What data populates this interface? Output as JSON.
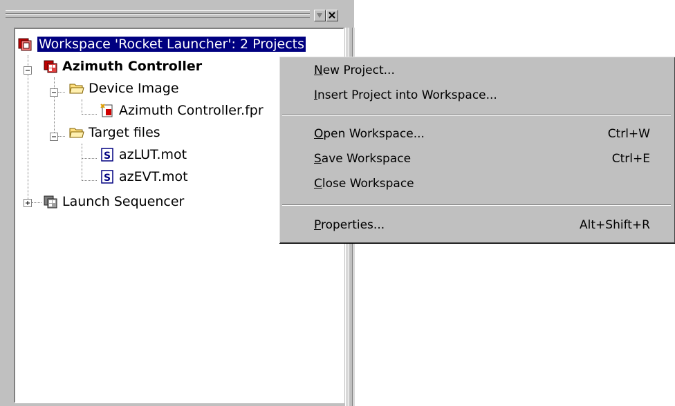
{
  "panel": {
    "title_buttons": [
      "restore-icon",
      "close-icon"
    ]
  },
  "tree": {
    "workspace": {
      "label": "Workspace 'Rocket Launcher': 2 Projects",
      "icon": "workspace-icon"
    },
    "project1": {
      "label": "Azimuth Controller",
      "icon": "project-icon"
    },
    "folder1": {
      "label": "Device Image",
      "icon": "folder-open-icon"
    },
    "file1": {
      "label": "Azimuth Controller.fpr",
      "icon": "device-image-file-icon"
    },
    "folder2": {
      "label": "Target files",
      "icon": "folder-open-icon"
    },
    "file2": {
      "label": "azLUT.mot",
      "icon": "s-record-file-icon"
    },
    "file3": {
      "label": "azEVT.mot",
      "icon": "s-record-file-icon"
    },
    "project2": {
      "label": "Launch Sequencer",
      "icon": "project-icon"
    }
  },
  "menu": {
    "new_project": {
      "label": "New Project...",
      "accel": "N",
      "shortcut": ""
    },
    "insert_project": {
      "label": "Insert Project into Workspace...",
      "accel": "I",
      "shortcut": ""
    },
    "open_workspace": {
      "label": "Open Workspace...",
      "accel": "O",
      "shortcut": "Ctrl+W"
    },
    "save_workspace": {
      "label": "Save Workspace",
      "accel": "S",
      "shortcut": "Ctrl+E"
    },
    "close_workspace": {
      "label": "Close Workspace",
      "accel": "C",
      "shortcut": ""
    },
    "properties": {
      "label": "Properties...",
      "accel": "P",
      "shortcut": "Alt+Shift+R"
    }
  }
}
